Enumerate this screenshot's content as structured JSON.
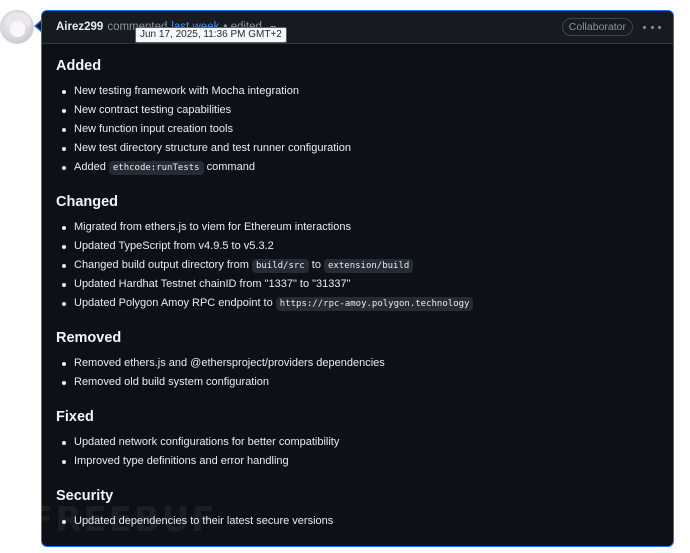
{
  "comment": {
    "author": "Airez299",
    "action": "commented",
    "time": "last week",
    "edited": "• edited",
    "role_badge": "Collaborator",
    "tooltip": "Jun 17, 2025, 11:36 PM GMT+2",
    "icons": {
      "avatar": "user-avatar",
      "edited_menu": "chevron-down-icon",
      "actions_menu": "kebab-horizontal-icon"
    }
  },
  "sections": [
    {
      "title": "Added",
      "items": [
        {
          "text": "New testing framework with Mocha integration"
        },
        {
          "text": "New contract testing capabilities"
        },
        {
          "text": "New function input creation tools"
        },
        {
          "text": "New test directory structure and test runner configuration"
        },
        {
          "pre": "Added ",
          "code": "ethcode:runTests",
          "post": " command"
        }
      ]
    },
    {
      "title": "Changed",
      "items": [
        {
          "text": "Migrated from ethers.js to viem for Ethereum interactions"
        },
        {
          "text": "Updated TypeScript from v4.9.5 to v5.3.2"
        },
        {
          "pre": "Changed build output directory from ",
          "code": "build/src",
          "mid": " to ",
          "code2": "extension/build"
        },
        {
          "text": "Updated Hardhat Testnet chainID from \"1337\" to \"31337\""
        },
        {
          "pre": "Updated Polygon Amoy RPC endpoint to ",
          "code": "https://rpc-amoy.polygon.technology"
        }
      ]
    },
    {
      "title": "Removed",
      "items": [
        {
          "text": "Removed ethers.js and @ethersproject/providers dependencies"
        },
        {
          "text": "Removed old build system configuration"
        }
      ]
    },
    {
      "title": "Fixed",
      "items": [
        {
          "text": "Updated network configurations for better compatibility"
        },
        {
          "text": "Improved type definitions and error handling"
        }
      ]
    },
    {
      "title": "Security",
      "items": [
        {
          "text": "Updated dependencies to their latest secure versions"
        }
      ]
    }
  ],
  "watermark": "FREEBUF",
  "colors": {
    "card_bg": "#0d1117",
    "header_bg": "#161b22",
    "border_accent": "#1f6feb",
    "link": "#4493f8",
    "text": "#e6edf3",
    "muted": "#8b949e",
    "code_bg": "#262c36"
  }
}
